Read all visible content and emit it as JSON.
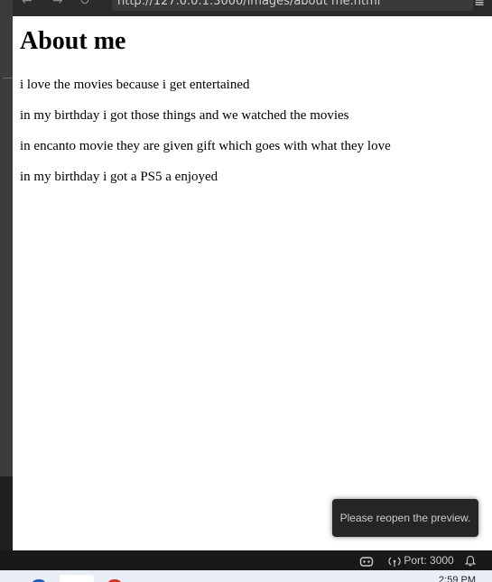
{
  "browser": {
    "url": "http://127.0.0.1:3000/images/about me.html",
    "back_icon": "arrow-left-icon",
    "forward_icon": "arrow-right-icon",
    "reload_icon": "reload-icon",
    "menu_icon": "hamburger-menu-icon"
  },
  "page": {
    "heading": "About me",
    "paragraphs": [
      "i love the movies because i get entertained",
      "in my birthday i got those things and we watched the movies",
      "in encanto movie they are given gift which goes with what they love",
      "in my birthday i got a PS5 a enjoyed"
    ]
  },
  "toast": {
    "message": "Please reopen the preview."
  },
  "statusbar": {
    "copilot_icon": "copilot-icon",
    "port_label": "Port: 3000",
    "broadcast_icon": "broadcast-icon",
    "bell_icon": "bell-icon"
  },
  "taskbar": {
    "time": "2:59 PM"
  },
  "colors": {
    "page_bg": "#ffffff",
    "chrome_bg": "#1f1f1f",
    "toast_bg": "#252526",
    "statusbar_bg": "#181818"
  }
}
